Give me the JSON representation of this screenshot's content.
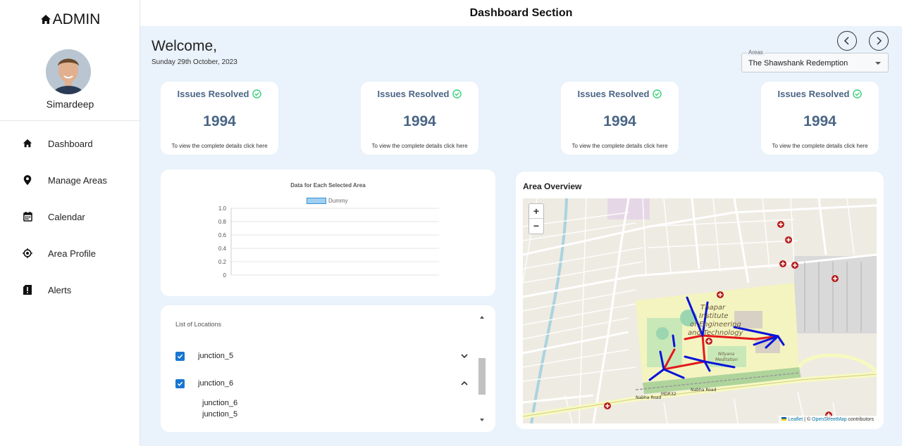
{
  "sidebar": {
    "brand": "ADMIN",
    "user_name": "Simardeep",
    "items": [
      {
        "label": "Dashboard",
        "icon": "home-icon"
      },
      {
        "label": "Manage Areas",
        "icon": "map-pin-icon"
      },
      {
        "label": "Calendar",
        "icon": "calendar-icon"
      },
      {
        "label": "Area Profile",
        "icon": "target-icon"
      },
      {
        "label": "Alerts",
        "icon": "alert-icon"
      }
    ]
  },
  "header": {
    "title": "Dashboard Section"
  },
  "welcome": {
    "greeting": "Welcome,",
    "date": "Sunday 29th October, 2023"
  },
  "areas": {
    "legend": "Areas",
    "selected": "The Shawshank Redemption"
  },
  "stats": [
    {
      "title": "Issues Resolved",
      "value": "1994",
      "note": "To view the complete details click here"
    },
    {
      "title": "Issues Resolved",
      "value": "1994",
      "note": "To view the complete details click here"
    },
    {
      "title": "Issues Resolved",
      "value": "1994",
      "note": "To view the complete details click here"
    },
    {
      "title": "Issues Resolved",
      "value": "1994",
      "note": "To view the complete details click here"
    }
  ],
  "chart_data": {
    "type": "bar",
    "title": "Data for Each Selected Area",
    "categories": [],
    "series": [
      {
        "name": "Dummy",
        "values": []
      }
    ],
    "ylim": [
      0,
      1.0
    ],
    "yticks": [
      "1.0",
      "0.8",
      "0.6",
      "0.4",
      "0.2",
      "0"
    ],
    "grid": true,
    "legend": "top"
  },
  "locations": {
    "title": "List of Locations",
    "items": [
      {
        "label": "junction_5",
        "checked": true,
        "expanded": false
      },
      {
        "label": "junction_6",
        "checked": true,
        "expanded": true
      }
    ],
    "sub_items": [
      "junction_6",
      "junction_5"
    ]
  },
  "map": {
    "title": "Area Overview",
    "zoom_in": "+",
    "zoom_out": "−",
    "labels": [
      "Thapar",
      "Institute",
      "of Engineering",
      "and Technology",
      "Nityana",
      "Meditation",
      "Nabha Road",
      "Nabha Road",
      "MDR32"
    ],
    "attribution_leaflet": "Leaflet",
    "attribution_sep": " | © ",
    "attribution_osm": "OpenStreetMap",
    "attribution_tail": " contributors"
  },
  "colors": {
    "accent": "#4a6585",
    "check": "#2ecc71",
    "checkbox": "#1976d2",
    "route_red": "#e31a1c",
    "route_blue": "#0a14d9"
  }
}
